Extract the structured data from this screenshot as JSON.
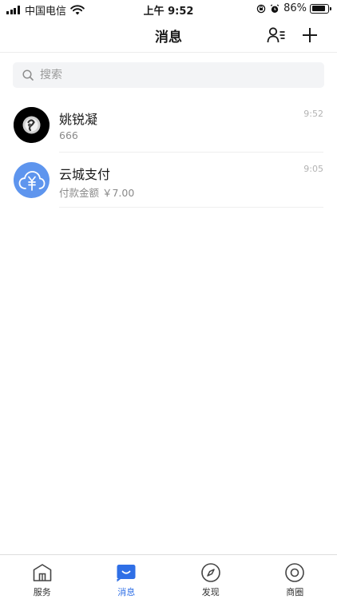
{
  "status_bar": {
    "carrier": "中国电信",
    "time": "上午 9:52",
    "battery_percent_text": "86%",
    "battery_level": 0.86,
    "icons": [
      "signal-icon",
      "wifi-icon",
      "orientation-lock-icon",
      "alarm-icon",
      "battery-icon"
    ]
  },
  "nav": {
    "title": "消息",
    "icons": [
      "contacts-icon",
      "plus-icon"
    ]
  },
  "search": {
    "placeholder": "搜索",
    "icon": "search-icon"
  },
  "chats": [
    {
      "name": "姚锐凝",
      "preview": "666",
      "time": "9:52",
      "avatar": "photo-avatar"
    },
    {
      "name": "云城支付",
      "preview": "付款金额 ￥7.00",
      "time": "9:05",
      "avatar": "cloud-payment-icon"
    }
  ],
  "tabs": [
    {
      "label": "服务",
      "icon": "store-icon",
      "active": false
    },
    {
      "label": "消息",
      "icon": "message-icon",
      "active": true
    },
    {
      "label": "发现",
      "icon": "compass-icon",
      "active": false
    },
    {
      "label": "商圈",
      "icon": "circle-icon",
      "active": false
    }
  ],
  "colors": {
    "accent": "#2f6fe6",
    "cloud_avatar_bg": "#5e95ee",
    "search_bg": "#f3f4f6",
    "muted_text": "#8a8a8a"
  }
}
